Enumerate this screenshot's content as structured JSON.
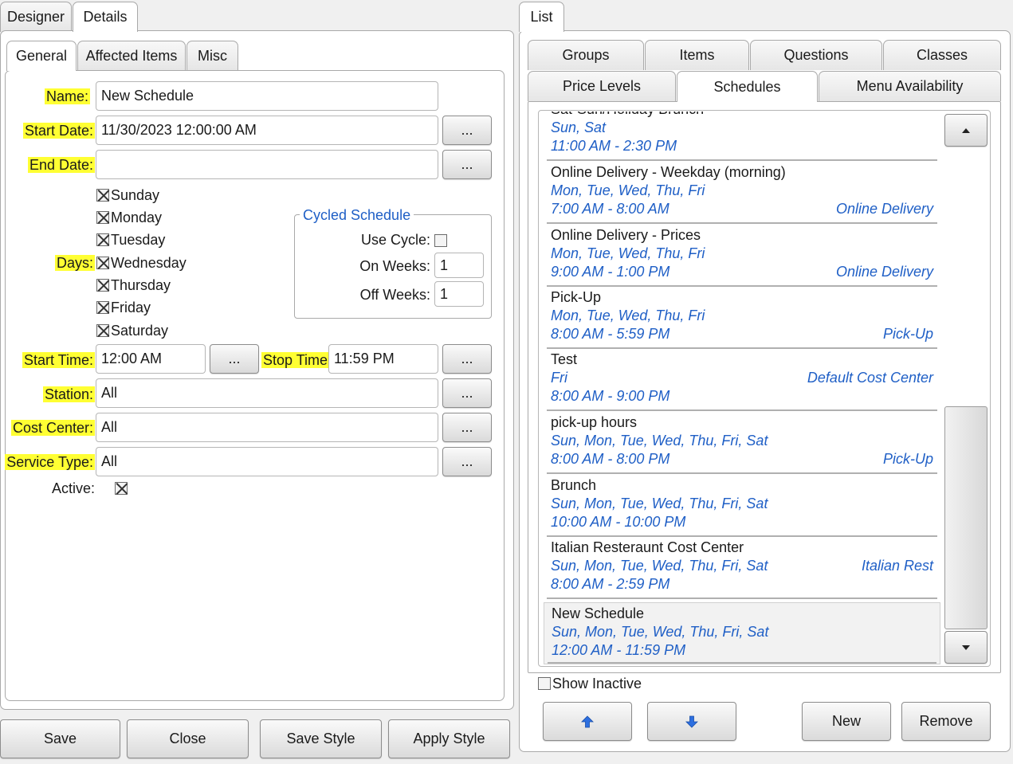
{
  "top_tabs": [
    "Designer",
    "Details"
  ],
  "sub_tabs": [
    "General",
    "Affected Items",
    "Misc"
  ],
  "form": {
    "name_label": "Name:",
    "name_value": "New Schedule",
    "start_date_label": "Start Date:",
    "start_date_value": "11/30/2023 12:00:00 AM",
    "end_date_label": "End Date:",
    "end_date_value": "",
    "days_label": "Days:",
    "days": [
      "Sunday",
      "Monday",
      "Tuesday",
      "Wednesday",
      "Thursday",
      "Friday",
      "Saturday"
    ],
    "start_time_label": "Start Time:",
    "start_time_value": "12:00 AM",
    "stop_time_label": "Stop Time:",
    "stop_time_value": "11:59 PM",
    "station_label": "Station:",
    "station_value": "All",
    "cost_center_label": "Cost Center:",
    "cost_center_value": "All",
    "service_type_label": "Service Type:",
    "service_type_value": "All",
    "active_label": "Active:",
    "ellipsis": "..."
  },
  "cycled": {
    "title": "Cycled Schedule",
    "use_cycle_label": "Use Cycle:",
    "on_weeks_label": "On Weeks:",
    "on_weeks_value": "1",
    "off_weeks_label": "Off Weeks:",
    "off_weeks_value": "1"
  },
  "bottom_buttons": [
    "Save",
    "Close",
    "Save Style",
    "Apply Style"
  ],
  "right": {
    "list_tab": "List",
    "tabs_row1": [
      "Groups",
      "Items",
      "Questions",
      "Classes"
    ],
    "tabs_row2": [
      "Price Levels",
      "Schedules",
      "Menu Availability"
    ],
    "show_inactive": "Show Inactive",
    "new_button": "New",
    "remove_button": "Remove",
    "schedules": [
      {
        "name": "Sat-Sun/Holiday Brunch",
        "days": "Sun, Sat",
        "time": "11:00 AM - 2:30 PM",
        "center": ""
      },
      {
        "name": "Online Delivery - Weekday (morning)",
        "days": "Mon, Tue, Wed, Thu, Fri",
        "time": "7:00 AM - 8:00 AM",
        "center": "Online Delivery"
      },
      {
        "name": "Online Delivery - Prices",
        "days": "Mon, Tue, Wed, Thu, Fri",
        "time": "9:00 AM - 1:00 PM",
        "center": "Online Delivery"
      },
      {
        "name": "Pick-Up",
        "days": "Mon, Tue, Wed, Thu, Fri",
        "time": "8:00 AM - 5:59 PM",
        "center": "Pick-Up"
      },
      {
        "name": "Test",
        "days": "Fri",
        "time": "8:00 AM - 9:00 PM",
        "center": "Default Cost Center"
      },
      {
        "name": "pick-up hours",
        "days": "Sun, Mon, Tue, Wed, Thu, Fri, Sat",
        "time": "8:00 AM - 8:00 PM",
        "center": "Pick-Up"
      },
      {
        "name": "Brunch",
        "days": "Sun, Mon, Tue, Wed, Thu, Fri, Sat",
        "time": "10:00 AM - 10:00 PM",
        "center": ""
      },
      {
        "name": "Italian Resteraunt Cost Center",
        "days": "Sun, Mon, Tue, Wed, Thu, Fri, Sat",
        "time": "8:00 AM - 2:59 PM",
        "center": "Italian Rest"
      },
      {
        "name": "New Schedule",
        "days": "Sun, Mon, Tue, Wed, Thu, Fri, Sat",
        "time": "12:00 AM - 11:59 PM",
        "center": ""
      }
    ]
  },
  "icons": [
    "scroll-up-arrow-icon",
    "scroll-down-arrow-icon",
    "move-up-arrow-icon",
    "move-down-arrow-icon",
    "checkbox-icon"
  ],
  "colors": {
    "highlight": "#ffff33",
    "link_blue": "#1f5fc6"
  }
}
